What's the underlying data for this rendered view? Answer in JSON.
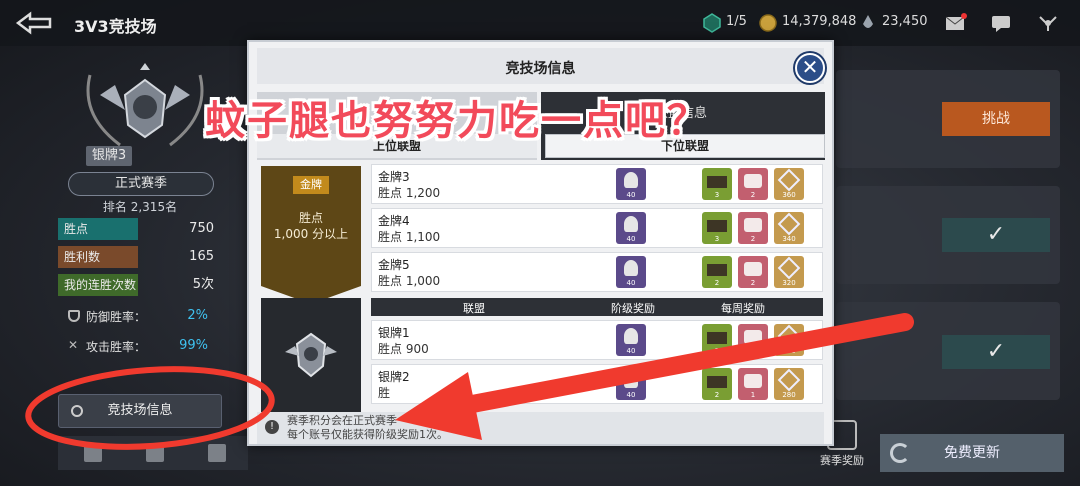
{
  "header": {
    "title": "3V3竞技场",
    "resources": [
      {
        "icon": "ticket-icon",
        "value": "1/5"
      },
      {
        "icon": "gold-coin-icon",
        "value": "14,379,848"
      },
      {
        "icon": "crystal-icon",
        "value": "23,450"
      }
    ]
  },
  "profile": {
    "rank_chip": "银牌3",
    "season": "正式赛季",
    "ranking": "排名 2,315名",
    "stats": [
      {
        "label": "胜点",
        "value": "750"
      },
      {
        "label": "胜利数",
        "value": "165"
      },
      {
        "label": "我的连胜次数",
        "value": "5次"
      }
    ],
    "rates": [
      {
        "label": "防御胜率：",
        "value": "2%"
      },
      {
        "label": "攻击胜率：",
        "value": "99%"
      }
    ],
    "info_button": "竞技场信息"
  },
  "right": {
    "challenge_label": "挑战",
    "season_reward_label": "赛季奖励",
    "refresh_label": "免费更新"
  },
  "modal": {
    "title": "竞技场信息",
    "tab_lower_label": "联盟信息",
    "upper_alliance": "上位联盟",
    "lower_alliance": "下位联盟",
    "gold_badge": "金牌",
    "gold_points_line1": "胜点",
    "gold_points_line2": "1,000 分以上",
    "col_alliance": "联盟",
    "col_tier_reward": "阶级奖励",
    "col_weekly_reward": "每周奖励",
    "tiers": [
      {
        "name": "金牌3",
        "points": "胜点 1,200",
        "tier_reward": "40",
        "weekly": [
          "3",
          "2",
          "360"
        ]
      },
      {
        "name": "金牌4",
        "points": "胜点 1,100",
        "tier_reward": "40",
        "weekly": [
          "3",
          "2",
          "340"
        ]
      },
      {
        "name": "金牌5",
        "points": "胜点 1,000",
        "tier_reward": "40",
        "weekly": [
          "2",
          "2",
          "320"
        ]
      },
      {
        "name": "银牌1",
        "points": "胜点 900",
        "tier_reward": "40",
        "weekly": [
          "2",
          "2",
          "300"
        ]
      },
      {
        "name": "银牌2",
        "points": "胜",
        "tier_reward": "40",
        "weekly": [
          "2",
          "1",
          "280"
        ]
      }
    ],
    "footer_line1": "赛季积分会在正式赛季",
    "footer_line2": "每个账号仅能获得阶级奖励1次。"
  },
  "annotation": {
    "caption": "蚊子腿也努努力吃一点吧？"
  },
  "colors": {
    "annotation_red": "#f03a2e",
    "challenge_orange": "#b9581f"
  }
}
